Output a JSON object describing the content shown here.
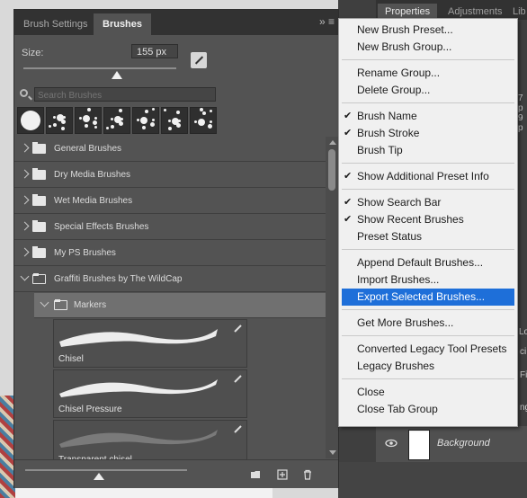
{
  "panel": {
    "tabs": [
      "Brush Settings",
      "Brushes"
    ],
    "menu_icons": "»  ≡",
    "size_label": "Size:",
    "size_value": "155 px",
    "search_placeholder": "Search Brushes"
  },
  "recent_brushes": [
    {
      "icon": "round-brush-icon"
    },
    {
      "icon": "splatter-brush-icon"
    },
    {
      "icon": "drip-brush-icon"
    },
    {
      "icon": "texture-brush-icon"
    },
    {
      "icon": "spray-brush-icon"
    },
    {
      "icon": "splash-brush-icon"
    },
    {
      "icon": "splat-brush-icon"
    }
  ],
  "groups": [
    {
      "label": "General Brushes"
    },
    {
      "label": "Dry Media Brushes"
    },
    {
      "label": "Wet Media Brushes"
    },
    {
      "label": "Special Effects Brushes"
    },
    {
      "label": "My PS Brushes"
    },
    {
      "label": "Graffiti Brushes by The WildCap"
    }
  ],
  "subgroup": {
    "label": "Markers"
  },
  "brushes": [
    {
      "name": "Chisel"
    },
    {
      "name": "Chisel Pressure"
    },
    {
      "name": "Transparent chisel"
    }
  ],
  "background_panel": {
    "tabs": [
      "Properties",
      "Adjustments",
      "Lib"
    ],
    "layer_name": "Background",
    "fragments": [
      "7 p",
      "9 p",
      "Lo",
      "ci",
      "ng",
      "Fi"
    ]
  },
  "menu": {
    "sections": [
      [
        {
          "label": "New Brush Preset...",
          "checked": false
        },
        {
          "label": "New Brush Group...",
          "checked": false
        }
      ],
      [
        {
          "label": "Rename Group...",
          "checked": false
        },
        {
          "label": "Delete Group...",
          "checked": false
        }
      ],
      [
        {
          "label": "Brush Name",
          "checked": true
        },
        {
          "label": "Brush Stroke",
          "checked": true
        },
        {
          "label": "Brush Tip",
          "checked": false
        }
      ],
      [
        {
          "label": "Show Additional Preset Info",
          "checked": true
        }
      ],
      [
        {
          "label": "Show Search Bar",
          "checked": true
        },
        {
          "label": "Show Recent Brushes",
          "checked": true
        },
        {
          "label": "Preset Status",
          "checked": false
        }
      ],
      [
        {
          "label": "Append Default Brushes...",
          "checked": false
        },
        {
          "label": "Import Brushes...",
          "checked": false
        },
        {
          "label": "Export Selected Brushes...",
          "checked": false,
          "highlighted": true
        }
      ],
      [
        {
          "label": "Get More Brushes...",
          "checked": false
        }
      ],
      [
        {
          "label": "Converted Legacy Tool Presets",
          "checked": false
        },
        {
          "label": "Legacy Brushes",
          "checked": false
        }
      ],
      [
        {
          "label": "Close",
          "checked": false
        },
        {
          "label": "Close Tab Group",
          "checked": false
        }
      ]
    ],
    "checkmark": "✔"
  }
}
